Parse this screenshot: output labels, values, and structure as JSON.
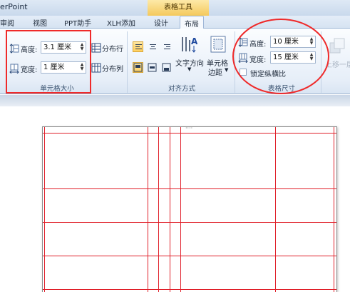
{
  "app": {
    "title": "erPoint",
    "contextual_tab_group": "表格工具"
  },
  "tabs": [
    {
      "label": "审阅"
    },
    {
      "label": "视图"
    },
    {
      "label": "PPT助手"
    },
    {
      "label": "XLH添加"
    },
    {
      "label": "设计"
    },
    {
      "label": "布局",
      "active": true
    }
  ],
  "cell_size": {
    "height_label": "高度:",
    "height_value": "3.1 厘米",
    "width_label": "宽度:",
    "width_value": "1 厘米",
    "distribute_rows": "分布行",
    "distribute_cols": "分布列",
    "group_label": "单元格大小"
  },
  "alignment": {
    "text_direction": "文字方向",
    "cell_margins_line1": "单元格",
    "cell_margins_line2": "边距",
    "group_label": "对齐方式"
  },
  "table_size": {
    "height_label": "高度:",
    "height_value": "10 厘米",
    "width_label": "宽度:",
    "width_value": "15 厘米",
    "lock_ratio": "锁定纵横比",
    "group_label": "表格尺寸"
  },
  "arrange": {
    "move_up": "上移一层"
  },
  "colors": {
    "highlight": "#ef2a2a",
    "table_lines": "#e0202a",
    "contextual_tab": "#f4c95c"
  }
}
